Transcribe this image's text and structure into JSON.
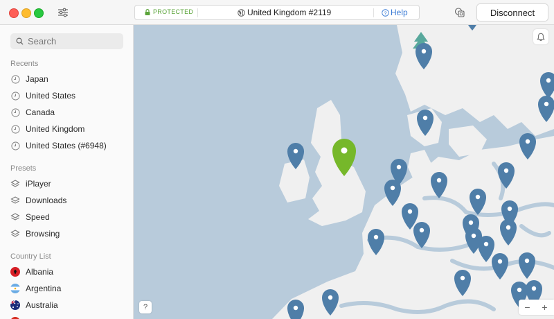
{
  "window": {
    "status": "PROTECTED",
    "server": "United Kingdom #2119",
    "help_label": "Help",
    "disconnect_label": "Disconnect"
  },
  "sidebar": {
    "search_placeholder": "Search",
    "recents_header": "Recents",
    "recents": [
      "Japan",
      "United States",
      "Canada",
      "United Kingdom",
      "United States (#6948)"
    ],
    "presets_header": "Presets",
    "presets": [
      "iPlayer",
      "Downloads",
      "Speed",
      "Browsing"
    ],
    "countries_header": "Country List",
    "countries": [
      "Albania",
      "Argentina",
      "Australia"
    ]
  },
  "map": {
    "help_label": "?",
    "zoom_out_label": "−",
    "zoom_in_label": "+",
    "colors": {
      "sea": "#b8cbdb",
      "land": "#f0f0f0",
      "pin": "#4f7ea8",
      "active_pin": "#76b82a",
      "tree": "#58a89c"
    }
  }
}
